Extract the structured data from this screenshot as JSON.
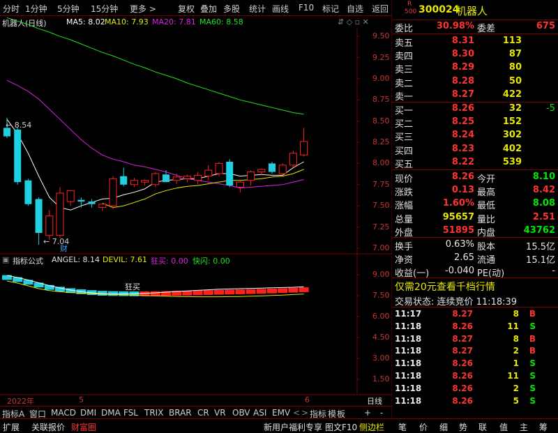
{
  "toolbar": [
    "分时",
    "1分钟",
    "5分钟",
    "15分钟",
    "更多 >",
    "复权",
    "叠加",
    "多股",
    "统计",
    "画线",
    "F10",
    "标记",
    "自选",
    "返回"
  ],
  "title": {
    "name": "机器人(日线)",
    "ma5": "MA5: 8.02",
    "ma10": "MA10: 7.93",
    "ma20": "MA20: 7.81",
    "ma60": "MA60: 8.58"
  },
  "price_axis": [
    "9.50",
    "9.25",
    "9.00",
    "8.75",
    "8.50",
    "8.25",
    "8.00",
    "7.75",
    "7.50",
    "7.25",
    "7.00"
  ],
  "indicator_axis": [
    "9.00",
    "7.50",
    "6.00",
    "4.50",
    "3.00",
    "1.50"
  ],
  "annotations": {
    "high": "8.54",
    "low": "7.04",
    "cai": "财",
    "kuangmai": "狂买"
  },
  "indicator_title": {
    "name": "指标公式",
    "angel": "ANGEL: 8.14",
    "devil": "DEVIL: 7.61",
    "kuangmai": "狂买: 0.00",
    "kuaishan": "快闪: 0.00"
  },
  "time_axis": {
    "year": "2022年",
    "m5": "5",
    "m6": "6",
    "right": "日线"
  },
  "bottom_tabs": [
    "指标A",
    "窗口",
    "MACD",
    "DMI",
    "DMA",
    "FSL",
    "TRIX",
    "BRAR",
    "CR",
    "VR",
    "OBV",
    "ASI",
    "EMV",
    "<",
    ">",
    "指标",
    "模",
    "板",
    "+",
    "-"
  ],
  "bottom_bar": {
    "left": [
      "扩展",
      "关联报价",
      "财富圈"
    ],
    "ad": "新用户福利专享",
    "tuwen": "图文F10",
    "sidebar": "侧边栏",
    "right": [
      "笔",
      "价",
      "细",
      "势",
      "联",
      "值",
      "主",
      "筹"
    ]
  },
  "quote": {
    "r_label": "R",
    "r_num": "500",
    "code": "300024",
    "name": "机器人",
    "weibi_label": "委比",
    "weibi": "30.98%",
    "weicha_label": "委差",
    "weicha": "675",
    "sells": [
      {
        "label": "卖五",
        "price": "8.31",
        "vol": "113"
      },
      {
        "label": "卖四",
        "price": "8.30",
        "vol": "87"
      },
      {
        "label": "卖三",
        "price": "8.29",
        "vol": "80"
      },
      {
        "label": "卖二",
        "price": "8.28",
        "vol": "50"
      },
      {
        "label": "卖一",
        "price": "8.27",
        "vol": "422"
      }
    ],
    "buys": [
      {
        "label": "买一",
        "price": "8.26",
        "vol": "32",
        "chg": "-5"
      },
      {
        "label": "买二",
        "price": "8.25",
        "vol": "152",
        "chg": ""
      },
      {
        "label": "买三",
        "price": "8.24",
        "vol": "302",
        "chg": ""
      },
      {
        "label": "买四",
        "price": "8.23",
        "vol": "402",
        "chg": ""
      },
      {
        "label": "买五",
        "price": "8.22",
        "vol": "539",
        "chg": ""
      }
    ],
    "stats": [
      {
        "l1": "现价",
        "v1": "8.26",
        "l2": "今开",
        "v2": "8.10"
      },
      {
        "l1": "涨跌",
        "v1": "0.13",
        "l2": "最高",
        "v2": "8.42"
      },
      {
        "l1": "涨幅",
        "v1": "1.60%",
        "l2": "最低",
        "v2": "8.08"
      },
      {
        "l1": "总量",
        "v1": "95657",
        "l2": "量比",
        "v2": "2.51"
      },
      {
        "l1": "外盘",
        "v1": "51895",
        "l2": "内盘",
        "v2": "43762"
      }
    ],
    "stats2": [
      {
        "l1": "换手",
        "v1": "0.63%",
        "l2": "股本",
        "v2": "15.5亿"
      },
      {
        "l1": "净资",
        "v1": "2.65",
        "l2": "流通",
        "v2": "15.1亿"
      },
      {
        "l1": "收益(一)",
        "v1": "-0.040",
        "l2": "PE(动)",
        "v2": "-"
      }
    ],
    "promo": "仅需20元查看千档行情",
    "status": "交易状态: 连续竞价 11:18:39"
  },
  "ticks": [
    {
      "t": "11:17",
      "p": "8.27",
      "v": "8",
      "d": "B"
    },
    {
      "t": "11:18",
      "p": "8.26",
      "v": "11",
      "d": "S"
    },
    {
      "t": "11:18",
      "p": "8.27",
      "v": "8",
      "d": "B"
    },
    {
      "t": "11:18",
      "p": "8.27",
      "v": "2",
      "d": "B"
    },
    {
      "t": "11:18",
      "p": "8.26",
      "v": "1",
      "d": "S"
    },
    {
      "t": "11:18",
      "p": "8.26",
      "v": "11",
      "d": "S"
    },
    {
      "t": "11:18",
      "p": "8.26",
      "v": "2",
      "d": "S"
    },
    {
      "t": "11:18",
      "p": "8.26",
      "v": "5",
      "d": "S"
    }
  ],
  "colors": {
    "up": "#ff2020",
    "down": "#20d0e0",
    "ma5": "#ffffff",
    "ma10": "#e8e800",
    "ma20": "#e020e0",
    "ma60": "#20e020",
    "border": "#7a0000"
  },
  "chart_data": {
    "type": "candlestick",
    "ylim": [
      6.95,
      9.6
    ],
    "candles": [
      {
        "o": 8.42,
        "h": 8.54,
        "l": 8.3,
        "c": 8.32
      },
      {
        "o": 8.4,
        "h": 8.42,
        "l": 7.75,
        "c": 7.78
      },
      {
        "o": 7.8,
        "h": 7.82,
        "l": 7.5,
        "c": 7.52
      },
      {
        "o": 7.58,
        "h": 7.6,
        "l": 7.04,
        "c": 7.18
      },
      {
        "o": 7.15,
        "h": 7.45,
        "l": 7.1,
        "c": 7.38
      },
      {
        "o": 7.15,
        "h": 7.72,
        "l": 7.12,
        "c": 7.65
      },
      {
        "o": 7.55,
        "h": 7.68,
        "l": 7.5,
        "c": 7.68
      },
      {
        "o": 7.57,
        "h": 7.6,
        "l": 7.48,
        "c": 7.55
      },
      {
        "o": 7.55,
        "h": 7.58,
        "l": 7.48,
        "c": 7.52
      },
      {
        "o": 7.48,
        "h": 7.52,
        "l": 7.44,
        "c": 7.52
      },
      {
        "o": 7.5,
        "h": 7.85,
        "l": 7.46,
        "c": 7.82
      },
      {
        "o": 7.85,
        "h": 7.95,
        "l": 7.73,
        "c": 7.75
      },
      {
        "o": 7.75,
        "h": 7.83,
        "l": 7.72,
        "c": 7.8
      },
      {
        "o": 7.78,
        "h": 7.81,
        "l": 7.74,
        "c": 7.8
      },
      {
        "o": 7.75,
        "h": 7.9,
        "l": 7.72,
        "c": 7.88
      },
      {
        "o": 7.87,
        "h": 7.92,
        "l": 7.78,
        "c": 7.78
      },
      {
        "o": 7.8,
        "h": 7.88,
        "l": 7.76,
        "c": 7.84
      },
      {
        "o": 7.82,
        "h": 7.87,
        "l": 7.78,
        "c": 7.85
      },
      {
        "o": 7.8,
        "h": 7.9,
        "l": 7.76,
        "c": 7.86
      },
      {
        "o": 7.85,
        "h": 7.98,
        "l": 7.8,
        "c": 7.92
      },
      {
        "o": 7.88,
        "h": 8.02,
        "l": 7.85,
        "c": 8.0
      },
      {
        "o": 8.02,
        "h": 8.05,
        "l": 7.72,
        "c": 7.74
      },
      {
        "o": 7.72,
        "h": 7.8,
        "l": 7.66,
        "c": 7.78
      },
      {
        "o": 7.8,
        "h": 7.92,
        "l": 7.74,
        "c": 7.9
      },
      {
        "o": 7.9,
        "h": 7.94,
        "l": 7.86,
        "c": 7.93
      },
      {
        "o": 8.0,
        "h": 8.02,
        "l": 7.88,
        "c": 7.9
      },
      {
        "o": 7.88,
        "h": 8.0,
        "l": 7.86,
        "c": 7.98
      },
      {
        "o": 7.98,
        "h": 8.15,
        "l": 7.96,
        "c": 8.12
      },
      {
        "o": 8.1,
        "h": 8.42,
        "l": 8.08,
        "c": 8.26
      }
    ],
    "ma5": [
      8.52,
      8.35,
      8.12,
      7.85,
      7.6,
      7.48,
      7.45,
      7.5,
      7.54,
      7.58,
      7.59,
      7.63,
      7.66,
      7.7,
      7.78,
      7.8,
      7.81,
      7.82,
      7.82,
      7.85,
      7.88,
      7.88,
      7.85,
      7.86,
      7.87,
      7.86,
      7.86,
      7.95,
      8.02
    ],
    "ma10": [
      null,
      null,
      null,
      null,
      null,
      null,
      null,
      null,
      null,
      7.53,
      7.48,
      7.5,
      7.54,
      7.58,
      7.64,
      7.68,
      7.71,
      7.73,
      7.74,
      7.76,
      7.78,
      7.8,
      7.8,
      7.81,
      7.82,
      7.84,
      7.85,
      7.88,
      7.93
    ],
    "ma20": [
      8.98,
      8.92,
      8.85,
      8.76,
      8.64,
      8.52,
      8.4,
      8.28,
      8.18,
      8.1,
      8.05,
      8.02,
      7.98,
      7.96,
      7.93,
      7.9,
      7.86,
      7.82,
      7.8,
      7.78,
      7.76,
      7.74,
      7.71,
      7.72,
      7.73,
      7.74,
      7.75,
      7.78,
      7.81
    ],
    "ma60": [
      9.72,
      9.68,
      9.64,
      9.59,
      9.55,
      9.5,
      9.46,
      9.41,
      9.36,
      9.31,
      9.27,
      9.22,
      9.17,
      9.13,
      9.08,
      9.04,
      9.0,
      8.95,
      8.91,
      8.87,
      8.83,
      8.79,
      8.75,
      8.72,
      8.69,
      8.66,
      8.63,
      8.6,
      8.58
    ],
    "indicator_ylim": [
      0.5,
      9.6
    ],
    "angel": [
      8.95,
      8.8,
      8.62,
      8.42,
      8.22,
      8.05,
      7.9,
      7.78,
      7.7,
      7.64,
      7.62,
      7.62,
      7.63,
      7.66,
      7.7,
      7.75,
      7.8,
      7.84,
      7.88,
      7.92,
      7.96,
      7.98,
      8.0,
      8.02,
      8.04,
      8.06,
      8.08,
      8.1,
      8.14
    ],
    "devil": [
      8.55,
      8.4,
      8.2,
      8.0,
      7.86,
      7.78,
      7.72,
      7.68,
      7.64,
      7.6,
      7.58,
      7.56,
      7.53,
      7.5,
      7.48,
      7.46,
      7.44,
      7.43,
      7.42,
      7.42,
      7.42,
      7.43,
      7.44,
      7.46,
      7.48,
      7.51,
      7.54,
      7.58,
      7.61
    ]
  }
}
